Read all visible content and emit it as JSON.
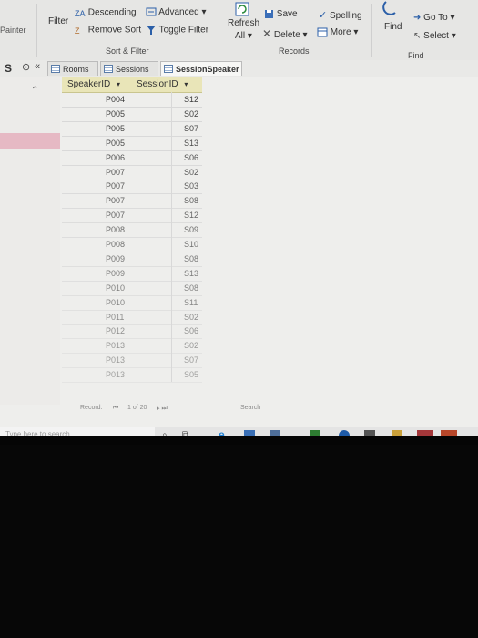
{
  "ribbon": {
    "painter_label": "Painter",
    "filter_label": "Filter",
    "descending_label": "Descending",
    "advanced_label": "Advanced",
    "remove_sort_label": "Remove Sort",
    "toggle_filter_label": "Toggle Filter",
    "sort_filter_group": "Sort & Filter",
    "refresh_label": "Refresh",
    "all_label": "All",
    "save_label": "Save",
    "delete_label": "Delete",
    "spelling_label": "Spelling",
    "more_label": "More",
    "records_group": "Records",
    "find_label": "Find",
    "goto_label": "Go To",
    "select_label": "Select",
    "find_group": "Find"
  },
  "nav": {
    "s_label": "S"
  },
  "tabs": [
    {
      "label": "Rooms"
    },
    {
      "label": "Sessions"
    },
    {
      "label": "SessionSpeaker"
    }
  ],
  "table": {
    "columns": [
      "SpeakerID",
      "SessionID"
    ],
    "rows": [
      [
        "P004",
        "S12"
      ],
      [
        "P005",
        "S02"
      ],
      [
        "P005",
        "S07"
      ],
      [
        "P005",
        "S13"
      ],
      [
        "P006",
        "S06"
      ],
      [
        "P007",
        "S02"
      ],
      [
        "P007",
        "S03"
      ],
      [
        "P007",
        "S08"
      ],
      [
        "P007",
        "S12"
      ],
      [
        "P008",
        "S09"
      ],
      [
        "P008",
        "S10"
      ],
      [
        "P009",
        "S08"
      ],
      [
        "P009",
        "S13"
      ],
      [
        "P010",
        "S08"
      ],
      [
        "P010",
        "S11"
      ],
      [
        "P011",
        "S02"
      ],
      [
        "P012",
        "S06"
      ],
      [
        "P013",
        "S02"
      ],
      [
        "P013",
        "S07"
      ],
      [
        "P013",
        "S05"
      ]
    ]
  },
  "record_nav": {
    "record_label": "Record:",
    "position": "1 of 20",
    "search_label": "Search"
  },
  "taskbar": {
    "search_placeholder": "Type here to search"
  },
  "colors": {
    "header_bg": "#e9e5b8",
    "selected_row": "#e6b9c4"
  }
}
